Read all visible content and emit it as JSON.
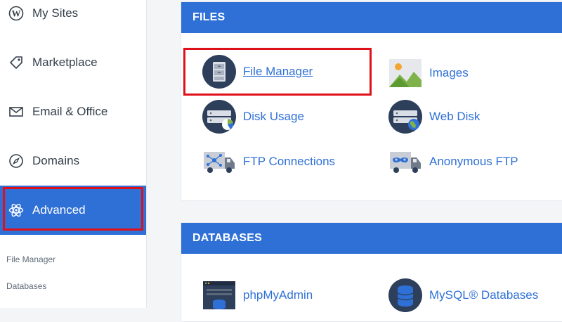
{
  "sidebar": {
    "items": [
      {
        "label": "My Sites",
        "icon": "wordpress-icon"
      },
      {
        "label": "Marketplace",
        "icon": "tag-icon"
      },
      {
        "label": "Email & Office",
        "icon": "envelope-icon"
      },
      {
        "label": "Domains",
        "icon": "compass-icon"
      },
      {
        "label": "Advanced",
        "icon": "atom-icon",
        "active": true
      }
    ],
    "sub_items": [
      "File Manager",
      "Databases"
    ]
  },
  "files": {
    "header": "FILES",
    "tools": [
      {
        "label": "File Manager",
        "icon": "file-cabinet-icon",
        "highlighted": true
      },
      {
        "label": "Images",
        "icon": "landscape-image-icon"
      },
      {
        "label": "Disk Usage",
        "icon": "disk-usage-icon"
      },
      {
        "label": "Web Disk",
        "icon": "web-disk-icon"
      },
      {
        "label": "FTP Connections",
        "icon": "ftp-truck-icon"
      },
      {
        "label": "Anonymous FTP",
        "icon": "anonymous-ftp-truck-icon"
      }
    ]
  },
  "databases": {
    "header": "DATABASES",
    "tools": [
      {
        "label": "phpMyAdmin",
        "icon": "phpmyadmin-icon"
      },
      {
        "label": "MySQL® Databases",
        "icon": "mysql-database-icon"
      }
    ]
  },
  "colors": {
    "accent": "#2f70d7",
    "highlight": "#e0101a",
    "icon_navy": "#2e3f5c"
  }
}
